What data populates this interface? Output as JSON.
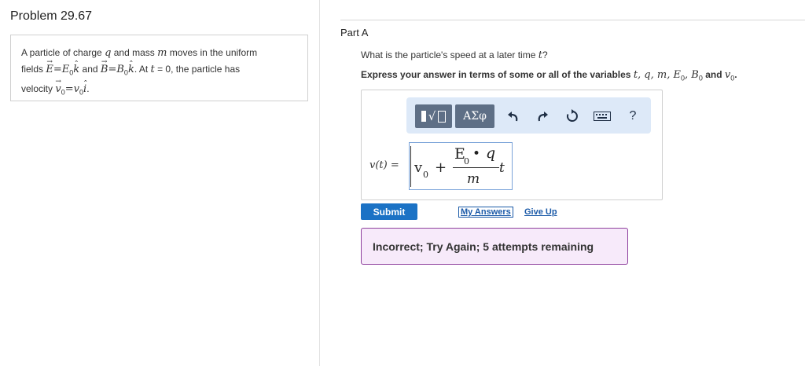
{
  "problem": {
    "title": "Problem 29.67",
    "text_1": "A particle of charge",
    "var_q": "q",
    "text_2": "and mass",
    "var_m": "m",
    "text_3": "moves in the uniform",
    "text_4": "fields",
    "E_vec": "E",
    "eq": "=",
    "E_mag": "E",
    "sub_0": "0",
    "k_hat": "k",
    "dot": ".",
    "text_and": "and",
    "B_vec": "B",
    "B_mag": "B",
    "text_5": ". At",
    "var_t": "t",
    "text_6": "= 0, the particle has",
    "text_7": "velocity",
    "v_vec": "v",
    "v_mag": "v",
    "i_hat": "i"
  },
  "part": {
    "title": "Part A",
    "question_text": "What is the particle's speed at a later time",
    "question_var": "t",
    "question_end": "?",
    "instruction_text": "Express your answer in terms of some or all of the variables",
    "instruction_vars": "t, q, m, E",
    "instruction_B": ", B",
    "instruction_v": "v",
    "instruction_and": "and",
    "instruction_comma": ",",
    "instruction_end": "."
  },
  "toolbar": {
    "templates_icon": "templates-icon",
    "symbols_label": "ΑΣφ",
    "undo_icon": "undo-icon",
    "redo_icon": "redo-icon",
    "reset_icon": "reset-icon",
    "keyboard_icon": "keyboard-icon",
    "help_label": "?"
  },
  "answer": {
    "label": "v(t) =",
    "term_v": "v",
    "sub_0": "0",
    "plus": "+",
    "num_E": "E",
    "num_dot": "•",
    "num_q": "q",
    "den_m": "m",
    "t": "t"
  },
  "actions": {
    "submit_label": "Submit",
    "my_answers_label": "My Answers",
    "give_up_label": "Give Up"
  },
  "feedback": {
    "message": "Incorrect; Try Again; 5 attempts remaining"
  },
  "colors": {
    "submit_bg": "#1b72c5",
    "toolbar_bg": "#dde9f8",
    "button_bg": "#5e6f86",
    "feedback_bg": "#f7eafa",
    "feedback_border": "#8e3f9d",
    "link": "#1b5aa8"
  }
}
